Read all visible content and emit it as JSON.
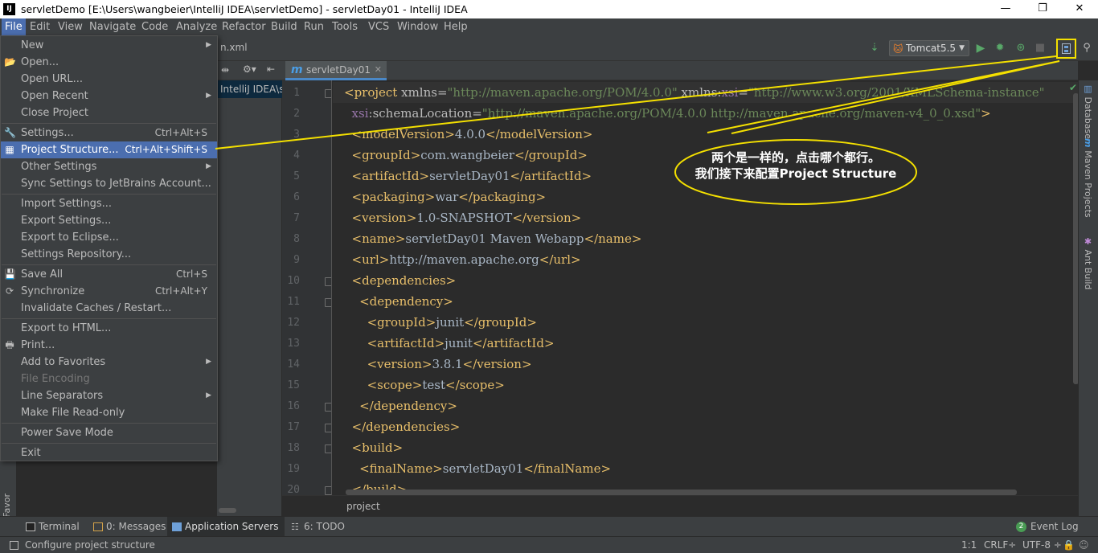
{
  "window": {
    "title": "servletDemo [E:\\Users\\wangbeier\\IntelliJ IDEA\\servletDemo] - servletDay01 - IntelliJ IDEA",
    "app_icon": "IJ",
    "minimize": "—",
    "restore": "❐",
    "close": "✕"
  },
  "menubar": {
    "items": [
      "File",
      "Edit",
      "View",
      "Navigate",
      "Code",
      "Analyze",
      "Refactor",
      "Build",
      "Run",
      "Tools",
      "VCS",
      "Window",
      "Help"
    ]
  },
  "toolbar": {
    "breadcrumb": "n.xml",
    "run_config": "Tomcat5.5"
  },
  "project_panel": {
    "selected_path": "IntelliJ IDEA\\se"
  },
  "editor": {
    "tab_label": "servletDay01",
    "breadcrumb": "project",
    "line_numbers": [
      "1",
      "2",
      "3",
      "4",
      "5",
      "6",
      "7",
      "8",
      "9",
      "10",
      "11",
      "12",
      "13",
      "14",
      "15",
      "16",
      "17",
      "18",
      "19",
      "20"
    ]
  },
  "code_lines": [
    [
      [
        "tag",
        "<project "
      ],
      [
        "attr",
        "xmlns="
      ],
      [
        "val",
        "\"http://maven.apache.org/POM/4.0.0\" "
      ],
      [
        "attr",
        "xmlns:"
      ],
      [
        "ns",
        "xsi"
      ],
      [
        "attr",
        "="
      ],
      [
        "val",
        "\"http://www.w3.org/2001/XMLSchema-instance\""
      ]
    ],
    [
      [
        "txt",
        "  "
      ],
      [
        "ns",
        "xsi"
      ],
      [
        "attr",
        ":schemaLocation="
      ],
      [
        "val",
        "\"http://maven.apache.org/POM/4.0.0 http://maven.apache.org/maven-v4_0_0.xsd\""
      ],
      [
        "tag",
        ">"
      ]
    ],
    [
      [
        "txt",
        "  "
      ],
      [
        "tag",
        "<modelVersion>"
      ],
      [
        "txt",
        "4.0.0"
      ],
      [
        "tag",
        "</modelVersion>"
      ]
    ],
    [
      [
        "txt",
        "  "
      ],
      [
        "tag",
        "<groupId>"
      ],
      [
        "txt",
        "com.wangbeier"
      ],
      [
        "tag",
        "</groupId>"
      ]
    ],
    [
      [
        "txt",
        "  "
      ],
      [
        "tag",
        "<artifactId>"
      ],
      [
        "txt",
        "servletDay01"
      ],
      [
        "tag",
        "</artifactId>"
      ]
    ],
    [
      [
        "txt",
        "  "
      ],
      [
        "tag",
        "<packaging>"
      ],
      [
        "txt",
        "war"
      ],
      [
        "tag",
        "</packaging>"
      ]
    ],
    [
      [
        "txt",
        "  "
      ],
      [
        "tag",
        "<version>"
      ],
      [
        "txt",
        "1.0-SNAPSHOT"
      ],
      [
        "tag",
        "</version>"
      ]
    ],
    [
      [
        "txt",
        "  "
      ],
      [
        "tag",
        "<name>"
      ],
      [
        "txt",
        "servletDay01 Maven Webapp"
      ],
      [
        "tag",
        "</name>"
      ]
    ],
    [
      [
        "txt",
        "  "
      ],
      [
        "tag",
        "<url>"
      ],
      [
        "txt",
        "http://maven.apache.org"
      ],
      [
        "tag",
        "</url>"
      ]
    ],
    [
      [
        "txt",
        "  "
      ],
      [
        "tag",
        "<dependencies>"
      ]
    ],
    [
      [
        "txt",
        "    "
      ],
      [
        "tag",
        "<dependency>"
      ]
    ],
    [
      [
        "txt",
        "      "
      ],
      [
        "tag",
        "<groupId>"
      ],
      [
        "txt",
        "junit"
      ],
      [
        "tag",
        "</groupId>"
      ]
    ],
    [
      [
        "txt",
        "      "
      ],
      [
        "tag",
        "<artifactId>"
      ],
      [
        "txt",
        "junit"
      ],
      [
        "tag",
        "</artifactId>"
      ]
    ],
    [
      [
        "txt",
        "      "
      ],
      [
        "tag",
        "<version>"
      ],
      [
        "txt",
        "3.8.1"
      ],
      [
        "tag",
        "</version>"
      ]
    ],
    [
      [
        "txt",
        "      "
      ],
      [
        "tag",
        "<scope>"
      ],
      [
        "txt",
        "test"
      ],
      [
        "tag",
        "</scope>"
      ]
    ],
    [
      [
        "txt",
        "    "
      ],
      [
        "tag",
        "</dependency>"
      ]
    ],
    [
      [
        "txt",
        "  "
      ],
      [
        "tag",
        "</dependencies>"
      ]
    ],
    [
      [
        "txt",
        "  "
      ],
      [
        "tag",
        "<build>"
      ]
    ],
    [
      [
        "txt",
        "    "
      ],
      [
        "tag",
        "<finalName>"
      ],
      [
        "txt",
        "servletDay01"
      ],
      [
        "tag",
        "</finalName>"
      ]
    ],
    [
      [
        "txt",
        "  "
      ],
      [
        "tag",
        "</build>"
      ]
    ]
  ],
  "file_menu": {
    "items": [
      {
        "label": "New",
        "submenu": true
      },
      {
        "label": "Open...",
        "icon": "folder-icon"
      },
      {
        "label": "Open URL..."
      },
      {
        "label": "Open Recent",
        "submenu": true
      },
      {
        "label": "Close Project"
      },
      {
        "sep": true
      },
      {
        "label": "Settings...",
        "shortcut": "Ctrl+Alt+S",
        "icon": "wrench-icon"
      },
      {
        "label": "Project Structure...",
        "shortcut": "Ctrl+Alt+Shift+S",
        "icon": "project-structure-icon",
        "selected": true
      },
      {
        "label": "Other Settings",
        "submenu": true
      },
      {
        "label": "Sync Settings to JetBrains Account..."
      },
      {
        "sep": true
      },
      {
        "label": "Import Settings..."
      },
      {
        "label": "Export Settings..."
      },
      {
        "label": "Export to Eclipse..."
      },
      {
        "label": "Settings Repository..."
      },
      {
        "sep": true
      },
      {
        "label": "Save All",
        "shortcut": "Ctrl+S",
        "icon": "save-icon"
      },
      {
        "label": "Synchronize",
        "shortcut": "Ctrl+Alt+Y",
        "icon": "sync-icon"
      },
      {
        "label": "Invalidate Caches / Restart..."
      },
      {
        "sep": true
      },
      {
        "label": "Export to HTML..."
      },
      {
        "label": "Print...",
        "icon": "print-icon"
      },
      {
        "label": "Add to Favorites",
        "submenu": true
      },
      {
        "label": "File Encoding",
        "disabled": true
      },
      {
        "label": "Line Separators",
        "submenu": true
      },
      {
        "label": "Make File Read-only"
      },
      {
        "sep": true
      },
      {
        "label": "Power Save Mode"
      },
      {
        "sep": true
      },
      {
        "label": "Exit"
      }
    ]
  },
  "left_strip": {
    "favorites_label": "2: Favor"
  },
  "right_strip": {
    "tabs": [
      "Database",
      "Maven Projects",
      "Ant Build"
    ]
  },
  "bottom_tabs": {
    "items": [
      "Terminal",
      "0: Messages",
      "Application Servers",
      "6: TODO"
    ],
    "active": "Application Servers",
    "event_log": "Event Log",
    "event_count": "2"
  },
  "statusbar": {
    "message": "Configure project structure",
    "position": "1:1",
    "line_sep": "CRLF÷",
    "encoding": "UTF-8 ÷"
  },
  "annotation": {
    "line1": "两个是一样的，点击哪个都行。",
    "line2": "我们接下来配置Project Structure",
    "color": "#f4e000"
  }
}
